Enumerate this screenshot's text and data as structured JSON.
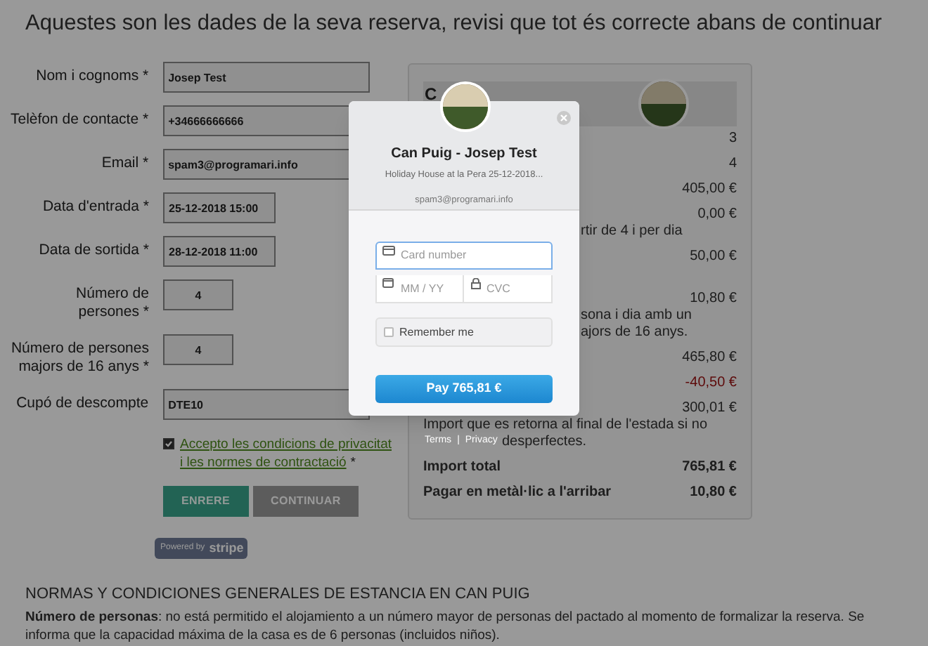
{
  "page_title": "Aquestes son les dades de la seva reserva, revisi que tot és correcte abans de continuar",
  "form": {
    "fields": [
      {
        "label": "Nom i cognoms *",
        "value": "Josep Test",
        "kind": "wide"
      },
      {
        "label": "Telèfon de contacte *",
        "value": "+34666666666",
        "kind": "wide"
      },
      {
        "label": "Email *",
        "value": "spam3@programari.info",
        "kind": "wide"
      },
      {
        "label": "Data d'entrada *",
        "value": "25-12-2018 15:00",
        "kind": "date"
      },
      {
        "label": "Data de sortida *",
        "value": "28-12-2018 11:00",
        "kind": "date"
      },
      {
        "label": "Número de\npersones *",
        "value": "4",
        "kind": "number"
      },
      {
        "label": "Número de persones\nmajors de 16 anys *",
        "value": "4",
        "kind": "number"
      },
      {
        "label": "Cupó de descompte",
        "value": "DTE10",
        "kind": "wide"
      }
    ],
    "consent": {
      "checked": true,
      "link_lines": [
        "Accepto les condicions de privacitat",
        "i les normes de contractació"
      ],
      "suffix": "*"
    },
    "buttons": [
      {
        "label": "ENRERE",
        "kind": "primary"
      },
      {
        "label": "CONTINUAR",
        "kind": "secondary"
      }
    ],
    "stripe_badge": {
      "prefix": "Powered by",
      "brand": "stripe"
    }
  },
  "summary": {
    "heading": "C",
    "rows": [
      {
        "value": "3"
      },
      {
        "value": "4"
      },
      {
        "value": "405,00 €"
      },
      {
        "value": "0,00 €",
        "notes": [
          {
            "text": "rtir de 4 i per dia",
            "under_dialog": true
          }
        ]
      },
      {
        "value": "50,00 €",
        "kind": "tall"
      },
      {
        "value": "10,80 €",
        "notes": [
          {
            "text": "sona i dia amb un",
            "under_dialog": true
          },
          {
            "text": "ajors de 16 anys.",
            "under_dialog": true
          }
        ]
      },
      {
        "value": "465,80 €"
      },
      {
        "value": "-40,50 €",
        "kind": "discount"
      },
      {
        "value": "300,01 €",
        "notes": [
          {
            "text": "Import que es retorna al final de l'estada si no"
          },
          {
            "text": "desperfectes.",
            "after_links": true
          }
        ]
      },
      {
        "label": "Import total",
        "value": "765,81 €",
        "kind": "total"
      },
      {
        "label": "Pagar en metàl·lic a l'arribar",
        "value": "10,80 €",
        "kind": "total"
      }
    ]
  },
  "modal": {
    "title": "Can Puig - Josep Test",
    "subtitle": "Holiday House at la Pera 25-12-2018...",
    "email": "spam3@programari.info",
    "card_number": {
      "placeholder": "Card number",
      "focused": true
    },
    "expiry": {
      "placeholder": "MM / YY"
    },
    "cvc": {
      "placeholder": "CVC"
    },
    "remember": {
      "label": "Remember me",
      "checked": false
    },
    "pay_button": "Pay 765,81 €"
  },
  "footer_links": {
    "items": [
      "Terms",
      "Privacy"
    ],
    "separator": "|"
  },
  "terms": {
    "heading": "NORMAS Y CONDICIONES GENERALES DE ESTANCIA EN CAN PUIG",
    "paragraph": "**Número de personas**: no está permitido el alojamiento a un número mayor de personas del pactado al momento de formalizar la reserva. Se informa que la capacidad máxima de la casa es de 6 personas (incluidos niños)."
  }
}
